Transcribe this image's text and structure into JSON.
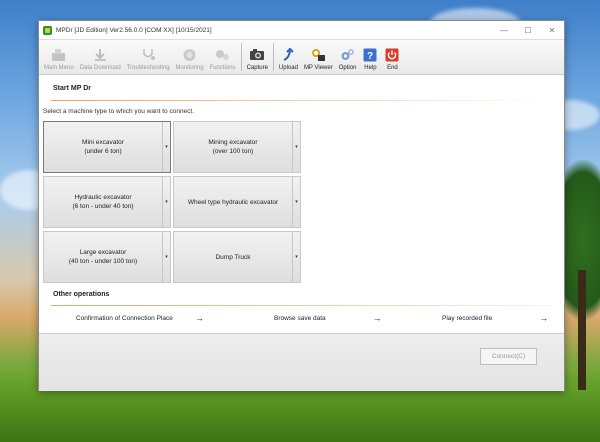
{
  "window": {
    "title": "MPDr [JD Edition] Ver2.56.0.0 [COM XX] [10/15/2021]",
    "controls": {
      "minimize": "—",
      "maximize": "☐",
      "close": "✕"
    }
  },
  "toolbar": {
    "items": [
      {
        "label": "Main Menu",
        "icon": "main-menu-icon",
        "enabled": false
      },
      {
        "label": "Data Download",
        "icon": "data-download-icon",
        "enabled": false
      },
      {
        "label": "Troubleshooting",
        "icon": "stethoscope-icon",
        "enabled": false
      },
      {
        "label": "Monitoring",
        "icon": "monitoring-icon",
        "enabled": false
      },
      {
        "label": "Functions",
        "icon": "functions-icon",
        "enabled": false
      },
      {
        "label": "Capture",
        "icon": "camera-icon",
        "enabled": true
      },
      {
        "label": "Upload",
        "icon": "upload-icon",
        "enabled": true
      },
      {
        "label": "MP Viewer",
        "icon": "mp-viewer-icon",
        "enabled": true
      },
      {
        "label": "Option",
        "icon": "option-icon",
        "enabled": true
      },
      {
        "label": "Help",
        "icon": "help-icon",
        "enabled": true
      },
      {
        "label": "End",
        "icon": "power-icon",
        "enabled": true
      }
    ]
  },
  "main": {
    "section_title": "Start MP Dr",
    "hint": "Select a machine type to which you want to connect.",
    "machines": [
      {
        "line1": "Mini excavator",
        "line2": "(under 6 ton)",
        "selected": true
      },
      {
        "line1": "Mining excavator",
        "line2": "(over 100 ton)",
        "selected": false
      },
      {
        "line1": "Hydraulic excavator",
        "line2": "(6 ton - under 40 ton)",
        "selected": false
      },
      {
        "line1": "Wheel type hydraulic excavator",
        "line2": "",
        "selected": false
      },
      {
        "line1": "Large excavator",
        "line2": "(40 ton - under 100 ton)",
        "selected": false
      },
      {
        "line1": "Dump Truck",
        "line2": "",
        "selected": false
      }
    ],
    "dropdown_glyph": "▾"
  },
  "other": {
    "title": "Other operations",
    "ops": [
      {
        "label": "Confirmation of Connection Place",
        "arrow": "→"
      },
      {
        "label": "Browse save data",
        "arrow": "→"
      },
      {
        "label": "Play recorded file",
        "arrow": "→"
      }
    ]
  },
  "footer": {
    "connect_label": "Connect(C)"
  },
  "colors": {
    "accent_rule": "#e9a36a",
    "end_red": "#d93b2b",
    "help_blue": "#3b6fd0"
  }
}
